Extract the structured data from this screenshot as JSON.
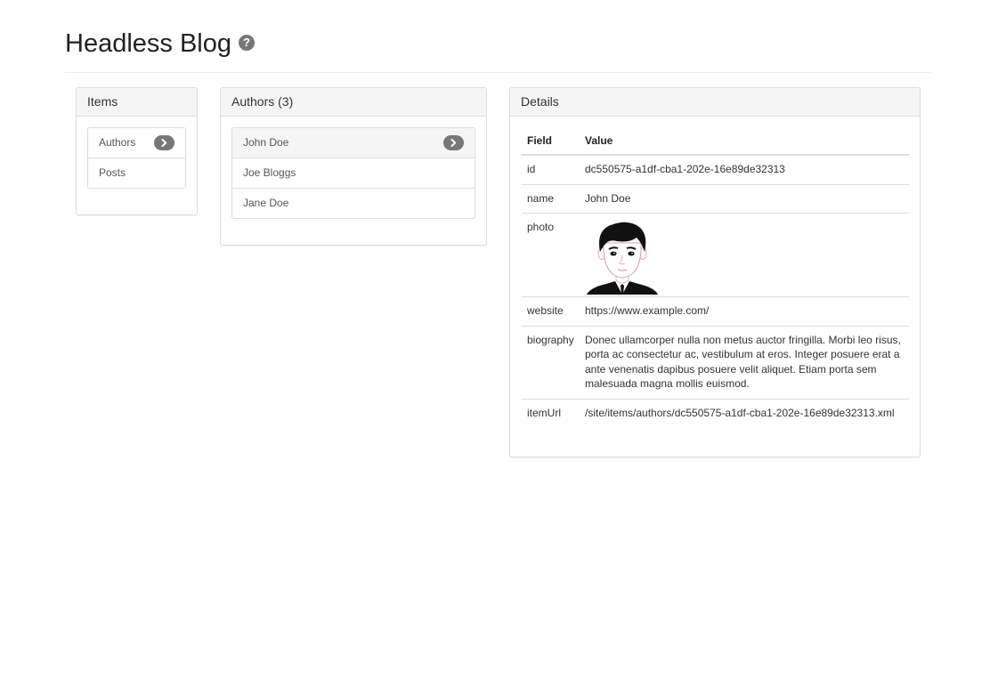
{
  "header": {
    "title": "Headless Blog",
    "help_glyph": "?"
  },
  "items_panel": {
    "title": "Items",
    "items": [
      {
        "label": "Authors",
        "active": true
      },
      {
        "label": "Posts",
        "active": false
      }
    ]
  },
  "authors_panel": {
    "title": "Authors (3)",
    "items": [
      {
        "label": "John Doe",
        "active": true
      },
      {
        "label": "Joe Bloggs",
        "active": false
      },
      {
        "label": "Jane Doe",
        "active": false
      }
    ]
  },
  "details_panel": {
    "title": "Details",
    "columns": {
      "field": "Field",
      "value": "Value"
    },
    "rows": {
      "id": {
        "field": "id",
        "value": "dc550575-a1df-cba1-202e-16e89de32313"
      },
      "name": {
        "field": "name",
        "value": "John Doe"
      },
      "photo": {
        "field": "photo",
        "icon": "man-avatar-photo"
      },
      "website": {
        "field": "website",
        "value": "https://www.example.com/"
      },
      "biography": {
        "field": "biography",
        "value": "Donec ullamcorper nulla non metus auctor fringilla. Morbi leo risus, porta ac consectetur ac, vestibulum at eros. Integer posuere erat a ante venenatis dapibus posuere velit aliquet. Etiam porta sem malesuada magna mollis euismod."
      },
      "itemUrl": {
        "field": "itemUrl",
        "value": "/site/items/authors/dc550575-a1df-cba1-202e-16e89de32313.xml"
      }
    }
  },
  "colors": {
    "badge": "#777777",
    "active_bg": "#f5f5f5",
    "border": "#dddddd"
  }
}
